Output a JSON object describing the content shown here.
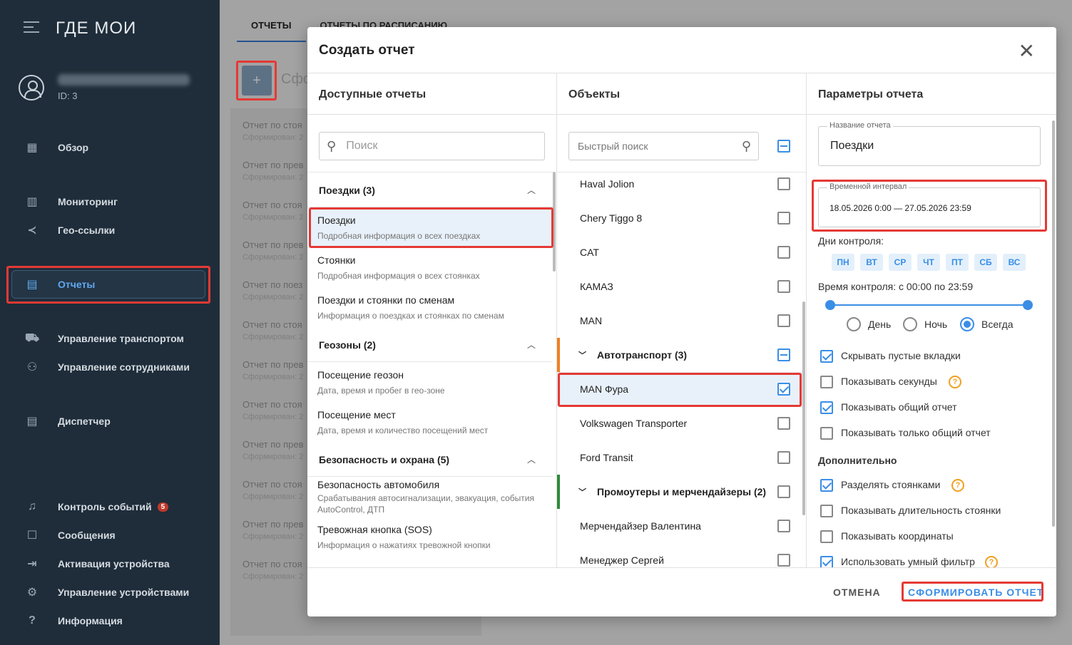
{
  "sidebar": {
    "logo": "ГДЕ МОИ",
    "user_id": "ID: 3",
    "items": [
      {
        "label": "Обзор",
        "icon": "dashboard-icon"
      },
      {
        "label": "Мониторинг",
        "icon": "map-icon"
      },
      {
        "label": "Гео-ссылки",
        "icon": "share-icon"
      },
      {
        "label": "Отчеты",
        "icon": "chart-icon"
      },
      {
        "label": "Управление транспортом",
        "icon": "car-icon"
      },
      {
        "label": "Управление сотрудниками",
        "icon": "people-icon"
      },
      {
        "label": "Диспетчер",
        "icon": "dispatcher-icon"
      },
      {
        "label": "Контроль событий",
        "icon": "bell-icon",
        "badge": "5"
      },
      {
        "label": "Сообщения",
        "icon": "message-icon"
      },
      {
        "label": "Активация устройства",
        "icon": "login-icon"
      },
      {
        "label": "Управление устройствами",
        "icon": "gear-icon"
      },
      {
        "label": "Информация",
        "icon": "help-icon"
      }
    ]
  },
  "background": {
    "tabs": [
      "ОТЧЕТЫ",
      "ОТЧЕТЫ ПО РАСПИСАНИЮ"
    ],
    "title_partial": "Сфо",
    "items": [
      {
        "title": "Отчет по стоя",
        "sub": "Сформирован: 2"
      },
      {
        "title": "Отчет по прев",
        "sub": "Сформирован: 2"
      },
      {
        "title": "Отчет по стоя",
        "sub": "Сформирован: 2"
      },
      {
        "title": "Отчет по прев",
        "sub": "Сформирован: 2"
      },
      {
        "title": "Отчет по поез",
        "sub": "Сформирован: 2"
      },
      {
        "title": "Отчет по стоя",
        "sub": "Сформирован: 2"
      },
      {
        "title": "Отчет по прев",
        "sub": "Сформирован: 2"
      },
      {
        "title": "Отчет по стоя",
        "sub": "Сформирован: 2"
      },
      {
        "title": "Отчет по прев",
        "sub": "Сформирован: 2"
      },
      {
        "title": "Отчет по стоя",
        "sub": "Сформирован: 2"
      },
      {
        "title": "Отчет по прев",
        "sub": "Сформирован: 2"
      },
      {
        "title": "Отчет по стоя",
        "sub": "Сформирован: 2"
      }
    ]
  },
  "modal": {
    "title": "Создать отчет",
    "available": {
      "header": "Доступные отчеты",
      "search_placeholder": "Поиск",
      "groups": [
        {
          "name": "Поездки (3)",
          "reports": [
            {
              "title": "Поездки",
              "desc": "Подробная информация о всех поездках"
            },
            {
              "title": "Стоянки",
              "desc": "Подробная информация о всех стоянках"
            },
            {
              "title": "Поездки и стоянки по сменам",
              "desc": "Информация о поездках и стоянках по сменам"
            }
          ]
        },
        {
          "name": "Геозоны (2)",
          "reports": [
            {
              "title": "Посещение геозон",
              "desc": "Дата, время и пробег в гео-зоне"
            },
            {
              "title": "Посещение мест",
              "desc": "Дата, время и количество посещений мест"
            }
          ]
        },
        {
          "name": "Безопасность и охрана (5)",
          "reports": [
            {
              "title": "Безопасность автомобиля",
              "desc": "Срабатывания автосигнализации, эвакуация, события AutoControl, ДТП"
            },
            {
              "title": "Тревожная кнопка (SOS)",
              "desc": "Информация о нажатиях тревожной кнопки"
            }
          ]
        }
      ]
    },
    "objects": {
      "header": "Объекты",
      "search_placeholder": "Быстрый поиск",
      "items": [
        {
          "name": "Haval Jolion",
          "checked": false
        },
        {
          "name": "Chery Tiggo 8",
          "checked": false
        },
        {
          "name": "CAT",
          "checked": false
        },
        {
          "name": "КАМАЗ",
          "checked": false
        },
        {
          "name": "MAN",
          "checked": false
        },
        {
          "name": "Автотранспорт (3)",
          "group": true,
          "color": "#f08020"
        },
        {
          "name": "MAN Фура",
          "checked": true
        },
        {
          "name": "Volkswagen Transporter",
          "checked": false
        },
        {
          "name": "Ford Transit",
          "checked": false
        },
        {
          "name": "Промоутеры и мерчендайзеры (2)",
          "group": true,
          "color": "#2e8b3a"
        },
        {
          "name": "Мерчендайзер Валентина",
          "checked": false
        },
        {
          "name": "Менеджер Сергей",
          "checked": false
        }
      ]
    },
    "params": {
      "header": "Параметры отчета",
      "name_label": "Название отчета",
      "name_value": "Поездки",
      "interval_label": "Временной интервал",
      "interval_value": "18.05.2026 0:00 — 27.05.2026 23:59",
      "days_label": "Дни контроля:",
      "days": [
        "ПН",
        "ВТ",
        "СР",
        "ЧТ",
        "ПТ",
        "СБ",
        "ВС"
      ],
      "time_label": "Время контроля: с 00:00 по 23:59",
      "radios": [
        "День",
        "Ночь",
        "Всегда"
      ],
      "opts": [
        {
          "label": "Скрывать пустые вкладки",
          "checked": true
        },
        {
          "label": "Показывать секунды",
          "checked": false,
          "help": true
        },
        {
          "label": "Показывать общий отчет",
          "checked": true
        },
        {
          "label": "Показывать только общий отчет",
          "checked": false
        }
      ],
      "extra_header": "Дополнительно",
      "extra_opts": [
        {
          "label": "Разделять стоянками",
          "checked": true,
          "help": true
        },
        {
          "label": "Показывать длительность стоянки",
          "checked": false
        },
        {
          "label": "Показывать координаты",
          "checked": false
        },
        {
          "label": "Использовать умный фильтр",
          "checked": true,
          "help": true
        }
      ]
    },
    "cancel": "ОТМЕНА",
    "submit": "СФОРМИРОВАТЬ ОТЧЕТ"
  },
  "colors": {
    "accent": "#3a8ee6",
    "sidebar": "#1f2d3a",
    "highlight": "#e53935"
  }
}
